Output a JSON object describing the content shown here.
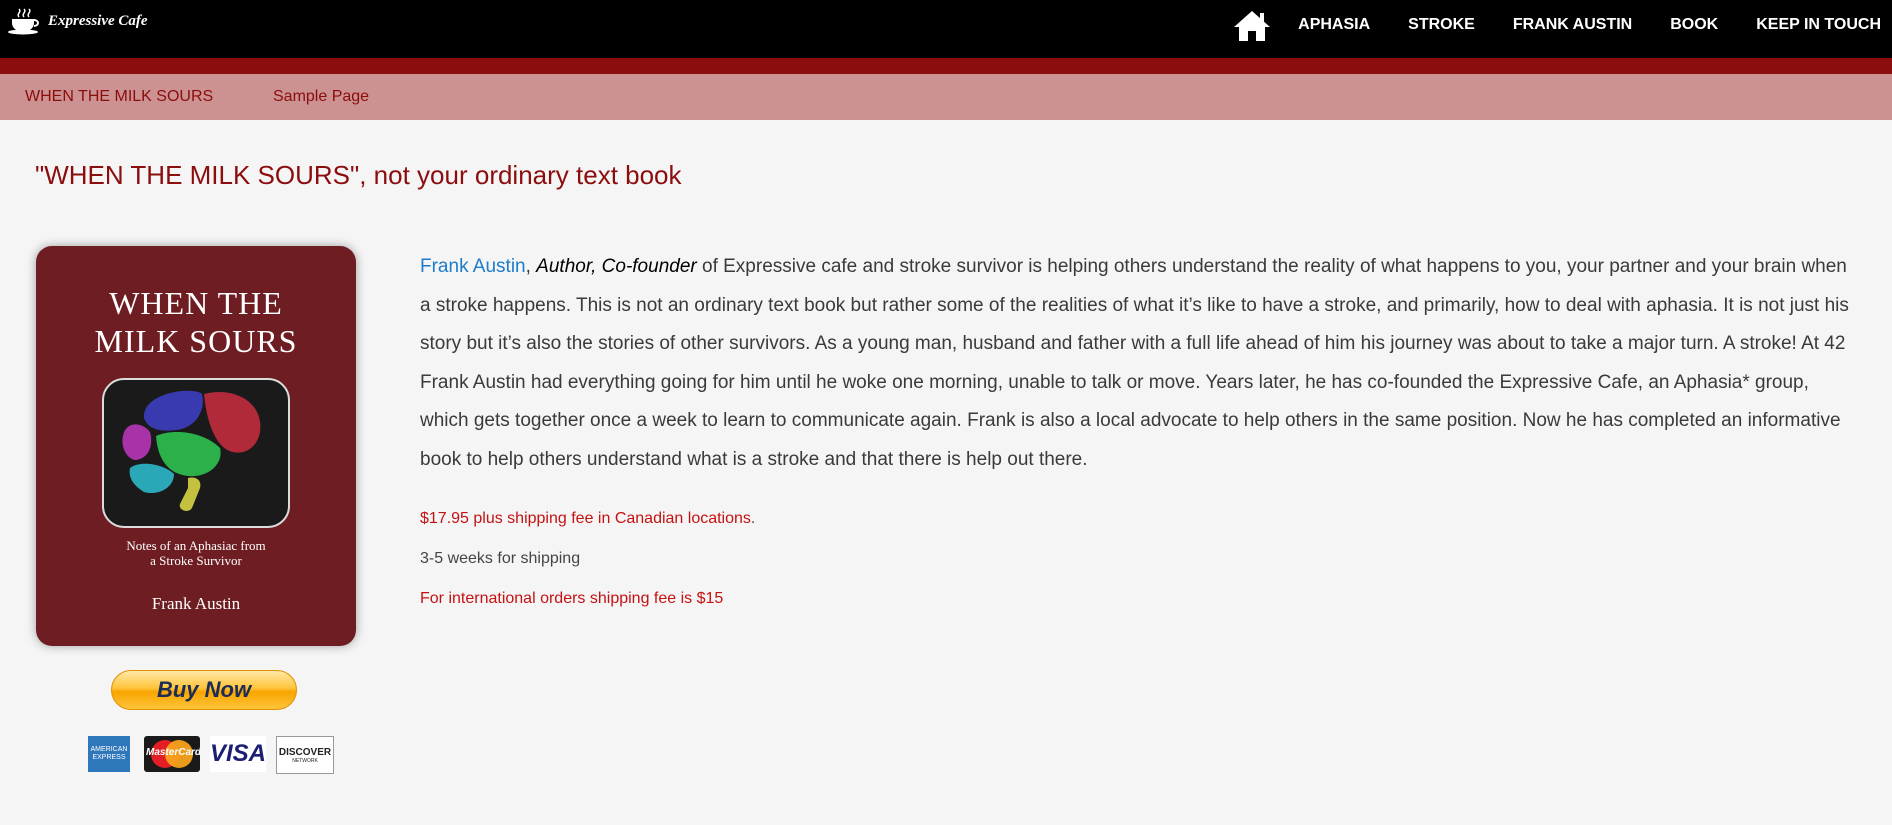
{
  "header": {
    "logo_text": "Expressive Cafe",
    "nav_items": [
      "APHASIA",
      "STROKE",
      "FRANK AUSTIN",
      "BOOK",
      "KEEP IN TOUCH"
    ]
  },
  "subnav": {
    "items": [
      "WHEN THE MILK SOURS",
      "Sample Page"
    ]
  },
  "main": {
    "title": "\"WHEN THE MILK SOURS\", not your ordinary text book",
    "book_cover": {
      "title_line1": "WHEN THE",
      "title_line2": "MILK SOURS",
      "subtitle_line1": "Notes of an Aphasiac from",
      "subtitle_line2": "a Stroke Survivor",
      "author": "Frank Austin"
    },
    "buy_button_label": "Buy Now",
    "payment_cards": {
      "amex": "AMERICAN EXPRESS",
      "mastercard": "MasterCard",
      "visa": "VISA",
      "discover": "DISCOVER",
      "discover_sub": "NETWORK"
    },
    "description": {
      "author_link": "Frank Austin",
      "comma": ",",
      "role": "Author, Co-founder",
      "body": " of Expressive cafe and stroke survivor is helping others understand the reality of what happens to you, your partner and your brain when a stroke happens. This is not an ordinary text book but rather some of the realities of what it’s like to have a stroke, and primarily, how to deal with aphasia. It is not just his story but it’s also the stories of other survivors. As a young man, husband and father with a full life ahead of him his journey was about to take a major turn. A stroke! At 42 Frank Austin had everything going for him until he woke one morning, unable to talk or move. Years later, he has co-founded the Expressive Cafe, an Aphasia* group, which gets together once a week to learn to communicate again. Frank is also a local advocate to help others in the same position. Now he has completed an informative book to help others understand what is a stroke and that there is help out there."
    },
    "price_text": "$17.95 plus shipping fee in Canadian locations",
    "price_period": ".",
    "shipping_time": "3-5 weeks for shipping",
    "international_shipping": "For international orders shipping fee is $15"
  },
  "colors": {
    "accent_red": "#8b0d0d",
    "subnav_bg": "#cc9191",
    "link_blue": "#1d7ccc",
    "price_red": "#c41212"
  }
}
